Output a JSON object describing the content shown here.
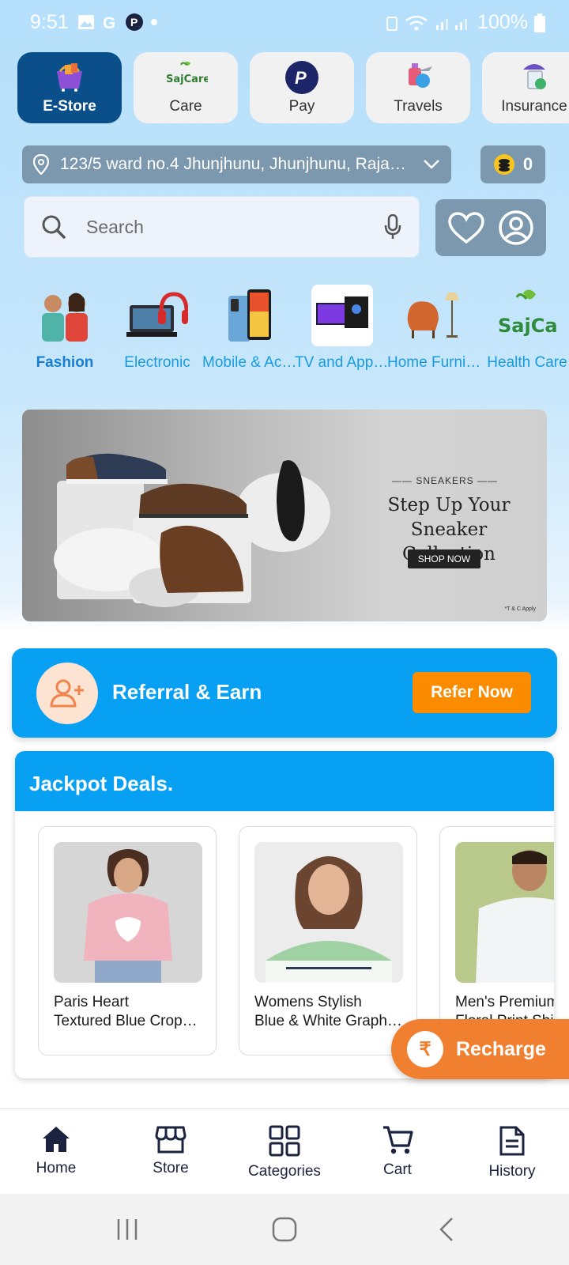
{
  "status_bar": {
    "time": "9:51",
    "battery": "100%"
  },
  "services": [
    {
      "label": "E-Store",
      "icon": "basket-icon",
      "active": true
    },
    {
      "label": "Care",
      "icon": "sajcare-logo",
      "logo_text": "SajCare",
      "active": false
    },
    {
      "label": "Pay",
      "icon": "pay-logo",
      "active": false
    },
    {
      "label": "Travels",
      "icon": "travel-icon",
      "active": false
    },
    {
      "label": "Insurance",
      "icon": "insurance-icon",
      "active": false
    }
  ],
  "location": {
    "address": "123/5 ward no.4 Jhunjhunu, Jhunjhunu, Rajasthan"
  },
  "coins": {
    "count": "0"
  },
  "search": {
    "placeholder": "Search"
  },
  "categories": [
    {
      "label": "Fashion",
      "active": true
    },
    {
      "label": "Electronic",
      "active": false
    },
    {
      "label": "Mobile & Accessories",
      "active": false
    },
    {
      "label": "TV and Appliances",
      "active": false
    },
    {
      "label": "Home Furniture",
      "active": false
    },
    {
      "label": "Health Care",
      "active": false
    }
  ],
  "category_logo_text": "SajCare",
  "banner": {
    "kicker": "—— SNEAKERS ——",
    "headline_1": "Step Up Your",
    "headline_2": "Sneaker Collection",
    "cta": "SHOP NOW",
    "terms": "*T & C Apply"
  },
  "referral": {
    "title": "Referral & Earn",
    "button": "Refer Now"
  },
  "deals": {
    "title": "Jackpot Deals.",
    "products": [
      {
        "line1": "Paris Heart",
        "line2": "Textured Blue Cropped T-Shirt"
      },
      {
        "line1": "Womens Stylish",
        "line2": "Blue & White Graphic T-Shirt"
      },
      {
        "line1": "Men's Premium",
        "line2": "Floral Print Shirt"
      }
    ]
  },
  "recharge": {
    "label": "Recharge",
    "symbol": "₹"
  },
  "bottom_nav": [
    {
      "label": "Home",
      "icon": "home-icon"
    },
    {
      "label": "Store",
      "icon": "store-icon"
    },
    {
      "label": "Categories",
      "icon": "grid-icon"
    },
    {
      "label": "Cart",
      "icon": "cart-icon"
    },
    {
      "label": "History",
      "icon": "document-icon"
    }
  ],
  "colors": {
    "primary_blue": "#08a0f3",
    "active_tab": "#0a4f89",
    "orange": "#fb8c00",
    "category_text": "#1a9be0",
    "bar_grey": "#7b98ae"
  }
}
